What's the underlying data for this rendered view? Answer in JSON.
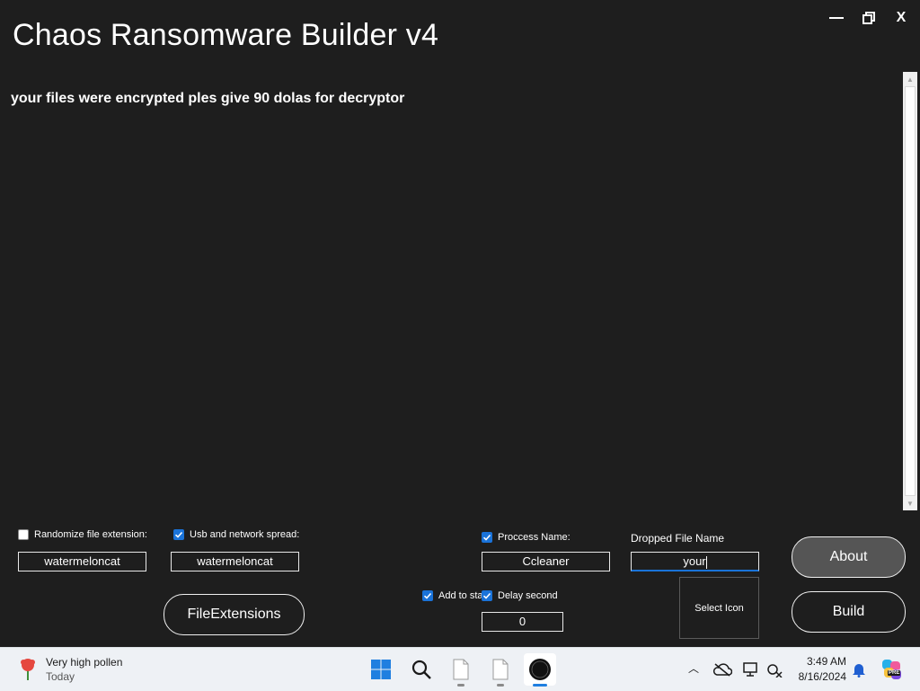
{
  "window": {
    "title": "Chaos Ransomware Builder v4",
    "minimize_glyph": "—",
    "maximize_glyph": "❐",
    "close_glyph": "X"
  },
  "message": {
    "text": "your files were encrypted ples give 90 dolas for decryptor"
  },
  "options": {
    "randomize_ext": {
      "label": "Randomize file extension:",
      "checked": false,
      "value": "watermeloncat"
    },
    "usb_spread": {
      "label": "Usb and network spread:",
      "checked": true,
      "value": "watermeloncat"
    },
    "file_extensions_button": "FileExtensions",
    "add_to_startup": {
      "label": "Add to sta",
      "checked": true
    },
    "delay_second": {
      "label": "Delay second",
      "checked": true,
      "value": "0"
    },
    "process_name": {
      "label": "Proccess Name:",
      "checked": true,
      "value": "Ccleaner"
    },
    "dropped_file_name": {
      "label": "Dropped File Name",
      "value": "your"
    },
    "select_icon_label": "Select Icon",
    "about_button": "About",
    "build_button": "Build"
  },
  "taskbar": {
    "weather_title": "Very high pollen",
    "weather_subtitle": "Today",
    "time": "3:49 AM",
    "date": "8/16/2024",
    "copilot_badge": "PRE"
  },
  "colors": {
    "background": "#1e1e1e",
    "checkbox_accent": "#1a73d9",
    "taskbar": "#eef1f5"
  }
}
